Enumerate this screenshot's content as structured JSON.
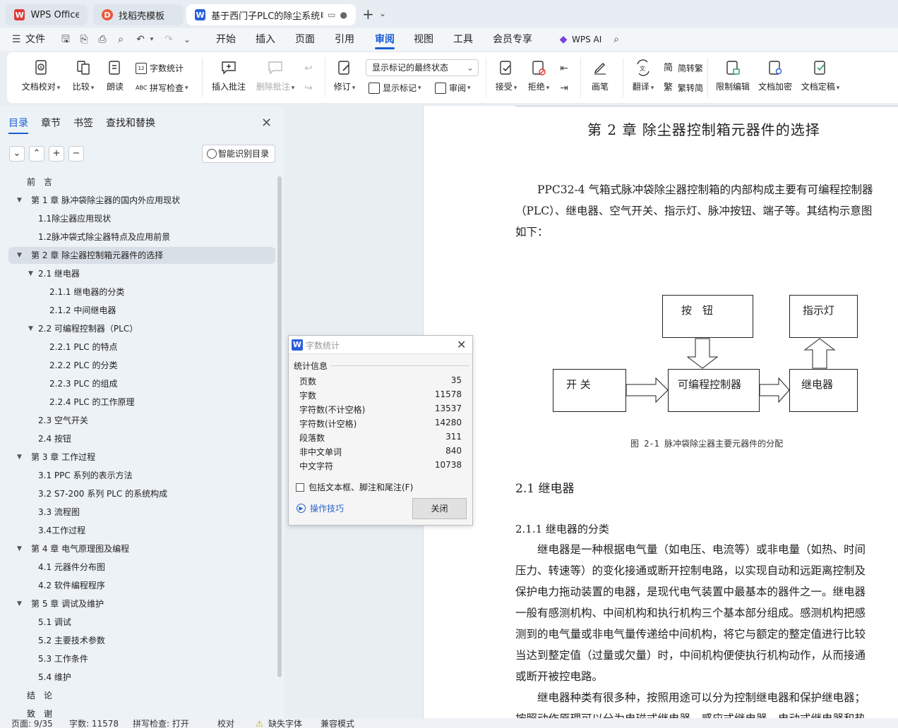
{
  "tabs": [
    {
      "label": "WPS Office",
      "logo": "W"
    },
    {
      "label": "找稻壳模板",
      "logo": "D"
    },
    {
      "label": "基于西门子PLC的除尘系统电",
      "logo": "W"
    }
  ],
  "menu": {
    "file": "文件",
    "items": [
      "开始",
      "插入",
      "页面",
      "引用",
      "审阅",
      "视图",
      "工具",
      "会员专享"
    ],
    "active": "审阅",
    "ai": "WPS AI"
  },
  "ribbon": {
    "doc_check": "文档校对",
    "compare": "比较",
    "read_aloud": "朗读",
    "word_count": "字数统计",
    "spell_check": "拼写检查",
    "insert_comment": "插入批注",
    "delete_comment": "删除批注",
    "revise": "修订",
    "markup_state": "显示标记的最终状态",
    "show_markup": "显示标记",
    "review": "审阅",
    "accept": "接受",
    "reject": "拒绝",
    "pen": "画笔",
    "translate": "翻译",
    "simp_to_trad": "简转繁",
    "trad_to_simp": "繁转简",
    "restrict_edit": "限制编辑",
    "encrypt": "文档加密",
    "finalize": "文档定稿"
  },
  "nav": {
    "tabs": [
      "目录",
      "章节",
      "书签",
      "查找和替换"
    ],
    "smart_toc": "智能识别目录",
    "toc": [
      {
        "label": "前　言",
        "level": 0,
        "arrow": false
      },
      {
        "label": "第 1 章  脉冲袋除尘器的国内外应用现状",
        "level": 0,
        "arrow": true
      },
      {
        "label": "1.1除尘器应用现状",
        "level": 1,
        "arrow": false
      },
      {
        "label": "1.2脉冲袋式除尘器特点及应用前景",
        "level": 1,
        "arrow": false
      },
      {
        "label": "第 2 章  除尘器控制箱元器件的选择",
        "level": 0,
        "arrow": true,
        "selected": true
      },
      {
        "label": "2.1  继电器",
        "level": 1,
        "arrow": true
      },
      {
        "label": "2.1.1  继电器的分类",
        "level": 2,
        "arrow": false
      },
      {
        "label": "2.1.2  中间继电器",
        "level": 2,
        "arrow": false
      },
      {
        "label": "2.2  可编程控制器（PLC）",
        "level": 1,
        "arrow": true
      },
      {
        "label": "2.2.1    PLC 的特点",
        "level": 2,
        "arrow": false
      },
      {
        "label": "2.2.2    PLC 的分类",
        "level": 2,
        "arrow": false
      },
      {
        "label": "2.2.3    PLC 的组成",
        "level": 2,
        "arrow": false
      },
      {
        "label": "2.2.4    PLC 的工作原理",
        "level": 2,
        "arrow": false
      },
      {
        "label": "2.3  空气开关",
        "level": 1,
        "arrow": false
      },
      {
        "label": "2.4  按钮",
        "level": 1,
        "arrow": false
      },
      {
        "label": "第 3 章  工作过程",
        "level": 0,
        "arrow": true
      },
      {
        "label": "3.1    PPC 系列的表示方法",
        "level": 1,
        "arrow": false
      },
      {
        "label": "3.2    S7-200 系列 PLC 的系统构成",
        "level": 1,
        "arrow": false
      },
      {
        "label": "3.3    流程图",
        "level": 1,
        "arrow": false
      },
      {
        "label": "3.4工作过程",
        "level": 1,
        "arrow": false
      },
      {
        "label": "第 4 章  电气原理图及编程",
        "level": 0,
        "arrow": true
      },
      {
        "label": "4.1 元器件分布图",
        "level": 1,
        "arrow": false
      },
      {
        "label": "4.2  软件编程程序",
        "level": 1,
        "arrow": false
      },
      {
        "label": "第 5 章  调试及维护",
        "level": 0,
        "arrow": true
      },
      {
        "label": "5.1  调试",
        "level": 1,
        "arrow": false
      },
      {
        "label": "5.2  主要技术参数",
        "level": 1,
        "arrow": false
      },
      {
        "label": "5.3  工作条件",
        "level": 1,
        "arrow": false
      },
      {
        "label": "5.4  维护",
        "level": 1,
        "arrow": false
      },
      {
        "label": "结　论",
        "level": 0,
        "arrow": false
      },
      {
        "label": "致　谢",
        "level": 0,
        "arrow": false
      }
    ]
  },
  "word_count_dialog": {
    "title": "字数统计",
    "section": "统计信息",
    "rows": [
      {
        "label": "页数",
        "value": "35"
      },
      {
        "label": "字数",
        "value": "11578"
      },
      {
        "label": "字符数(不计空格)",
        "value": "13537"
      },
      {
        "label": "字符数(计空格)",
        "value": "14280"
      },
      {
        "label": "段落数",
        "value": "311"
      },
      {
        "label": "非中文单词",
        "value": "840"
      },
      {
        "label": "中文字符",
        "value": "10738"
      }
    ],
    "include_label": "包括文本框、脚注和尾注(F)",
    "tips": "操作技巧",
    "close": "关闭"
  },
  "document": {
    "chapter_title": "第 2 章  除尘器控制箱元器件的选择",
    "para1": [
      "　　PPC32-4 气箱式脉冲袋除尘器控制箱的内部构成主要有可编程控制器",
      "（PLC）、继电器、空气开关、指示灯、脉冲按钮、端子等。其结构示意图",
      "如下："
    ],
    "diagram": {
      "button": "按　钮",
      "indicator": "指示灯",
      "switch": "开  关",
      "plc": "可编程控制器",
      "relay": "继电器"
    },
    "figure_caption": "图 2-1  脉冲袋除尘器主要元器件的分配",
    "h2": "2.1  继电器",
    "h3": "2.1.1  继电器的分类",
    "para2": [
      "　　继电器是一种根据电气量（如电压、电流等）或非电量（如热、时间",
      "压力、转速等）的变化接通或断开控制电路，以实现自动和远距离控制及",
      "保护电力拖动装置的电器，是现代电气装置中最基本的器件之一。继电器",
      "一般有感测机构、中间机构和执行机构三个基本部分组成。感测机构把感",
      "测到的电气量或非电气量传递给中间机构，将它与额定的整定值进行比较",
      "当达到整定值（过量或欠量）时，中间机构便使执行机构动作，从而接通",
      "或断开被控电路。",
      "　　继电器种类有很多种，按照用途可以分为控制继电器和保护继电器；",
      "按照动作原理可以分为电磁式继电器、感应式继电器、电动式继电器和热"
    ]
  },
  "status": {
    "page": "页面: 9/35",
    "words": "字数: 11578",
    "spell": "拼写检查: 打开",
    "proof": "校对",
    "missing_font": "缺失字体",
    "compat": "兼容模式"
  }
}
